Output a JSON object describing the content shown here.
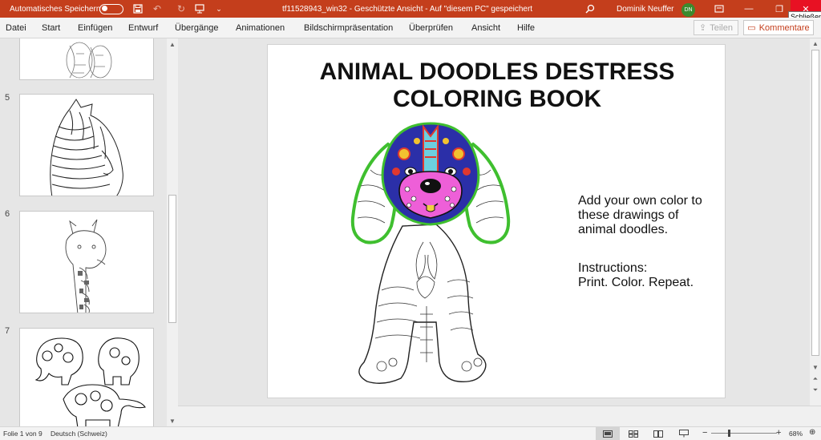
{
  "titlebar": {
    "autosave_label": "Automatisches Speichern",
    "doc_title": "tf11528943_win32  -  Geschützte Ansicht  -  Auf \"diesem PC\" gespeichert",
    "user_name": "Dominik Neuffer",
    "user_initials": "DN",
    "tooltip": "Schließen",
    "accent_color": "#c43e1c"
  },
  "menu": {
    "items": [
      "Datei",
      "Start",
      "Einfügen",
      "Entwurf",
      "Übergänge",
      "Animationen",
      "Bildschirmpräsentation",
      "Überprüfen",
      "Ansicht",
      "Hilfe"
    ],
    "share_label": "Teilen",
    "comments_label": "Kommentare"
  },
  "thumbnails": [
    {
      "number": "5",
      "subject": "zebra"
    },
    {
      "number": "6",
      "subject": "giraffe"
    },
    {
      "number": "7",
      "subject": "elephants"
    }
  ],
  "slide": {
    "title_line1": "ANIMAL DOODLES DESTRESS",
    "title_line2": "COLORING BOOK",
    "body_line1": "Add your own color to",
    "body_line2": "these drawings of",
    "body_line3": "animal doodles.",
    "body_line4": "Instructions:",
    "body_line5": "Print.  Color.  Repeat."
  },
  "status": {
    "slide_count": "Folie 1 von 9",
    "language": "Deutsch (Schweiz)",
    "zoom": "68%",
    "zoom_fraction": 0.55
  }
}
